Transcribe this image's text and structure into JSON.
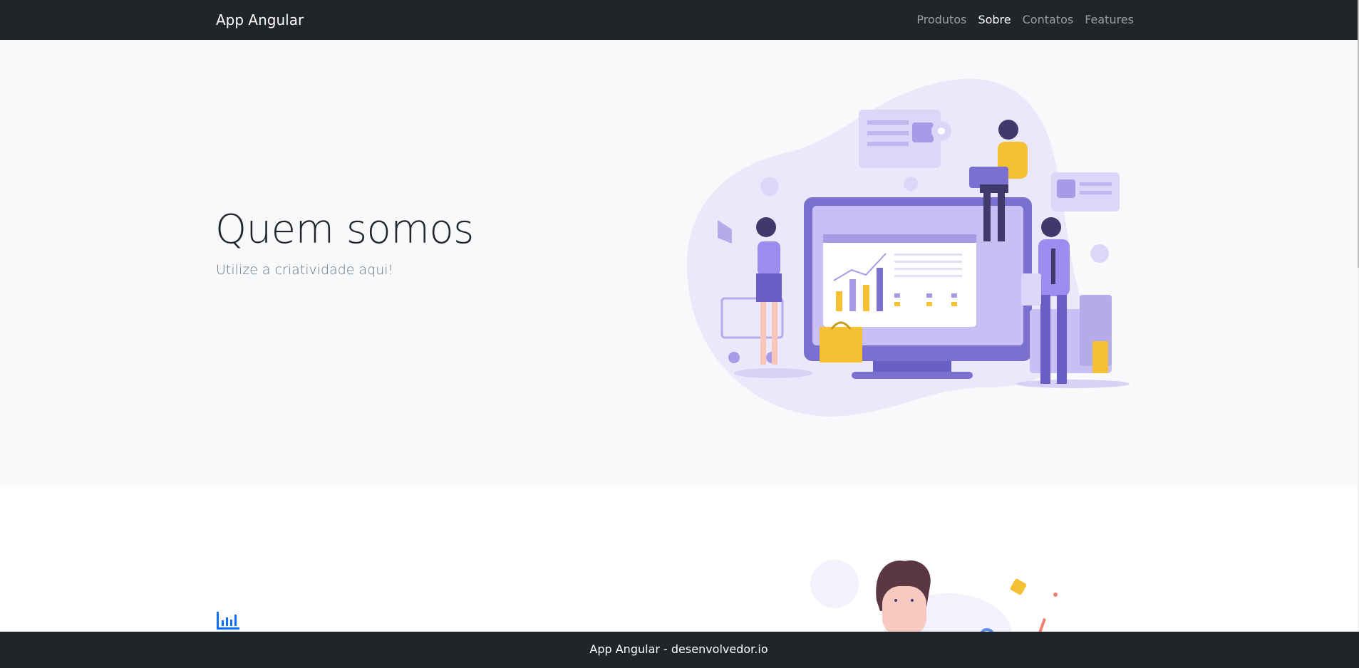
{
  "navbar": {
    "brand": "App Angular",
    "links": [
      {
        "label": "Produtos",
        "active": false
      },
      {
        "label": "Sobre",
        "active": true
      },
      {
        "label": "Contatos",
        "active": false
      },
      {
        "label": "Features",
        "active": false
      }
    ]
  },
  "hero": {
    "title": "Quem somos",
    "subtitle": "Utilize a criatividade aqui!",
    "illustration_icon": "marketing-team-illustration"
  },
  "section2": {
    "icon": "bar-chart-icon",
    "illustration_icon": "person-illustration"
  },
  "footer": {
    "text": "App Angular - desenvolvedor.io"
  },
  "colors": {
    "navbar_bg": "#212529",
    "hero_bg": "#f8f9fa",
    "accent": "#0d6efd",
    "illustration_purple": "#7b6fd0",
    "illustration_yellow": "#f5c033"
  }
}
